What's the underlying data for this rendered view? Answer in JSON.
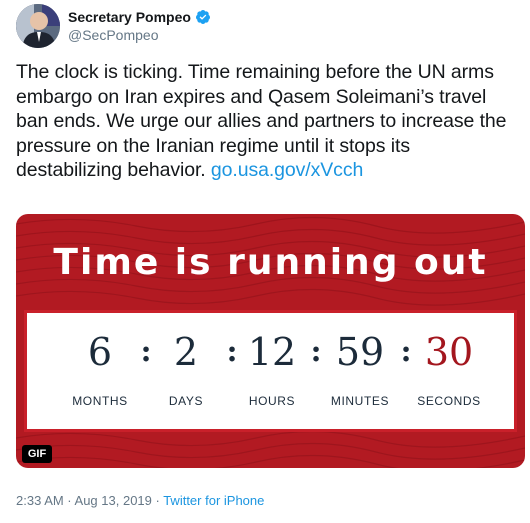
{
  "author": {
    "name": "Secretary Pompeo",
    "handle": "@SecPompeo",
    "verified_icon": "verified-badge-icon"
  },
  "tweet": {
    "text": "The clock is ticking. Time remaining before the UN arms embargo on Iran expires and Qasem Soleimani’s travel ban ends. We urge our allies and partners to increase the pressure on the Iranian regime until it stops its destabilizing behavior. ",
    "link": "go.usa.gov/xVcch"
  },
  "media": {
    "headline": "Time is running out",
    "background_color": "#b21a22",
    "countdown": [
      {
        "value": "6",
        "label": "MONTHS"
      },
      {
        "value": "2",
        "label": "DAYS"
      },
      {
        "value": "12",
        "label": "HOURS"
      },
      {
        "value": "59",
        "label": "MINUTES"
      },
      {
        "value": "30",
        "label": "SECONDS"
      }
    ],
    "separator": ":",
    "badge": "GIF"
  },
  "footer": {
    "timestamp": "2:33 AM · Aug 13, 2019 · ",
    "source": "Twitter for iPhone"
  },
  "colors": {
    "link": "#1b95e0",
    "seconds_value": "#a3161e",
    "number_text": "#1c2b3a"
  }
}
